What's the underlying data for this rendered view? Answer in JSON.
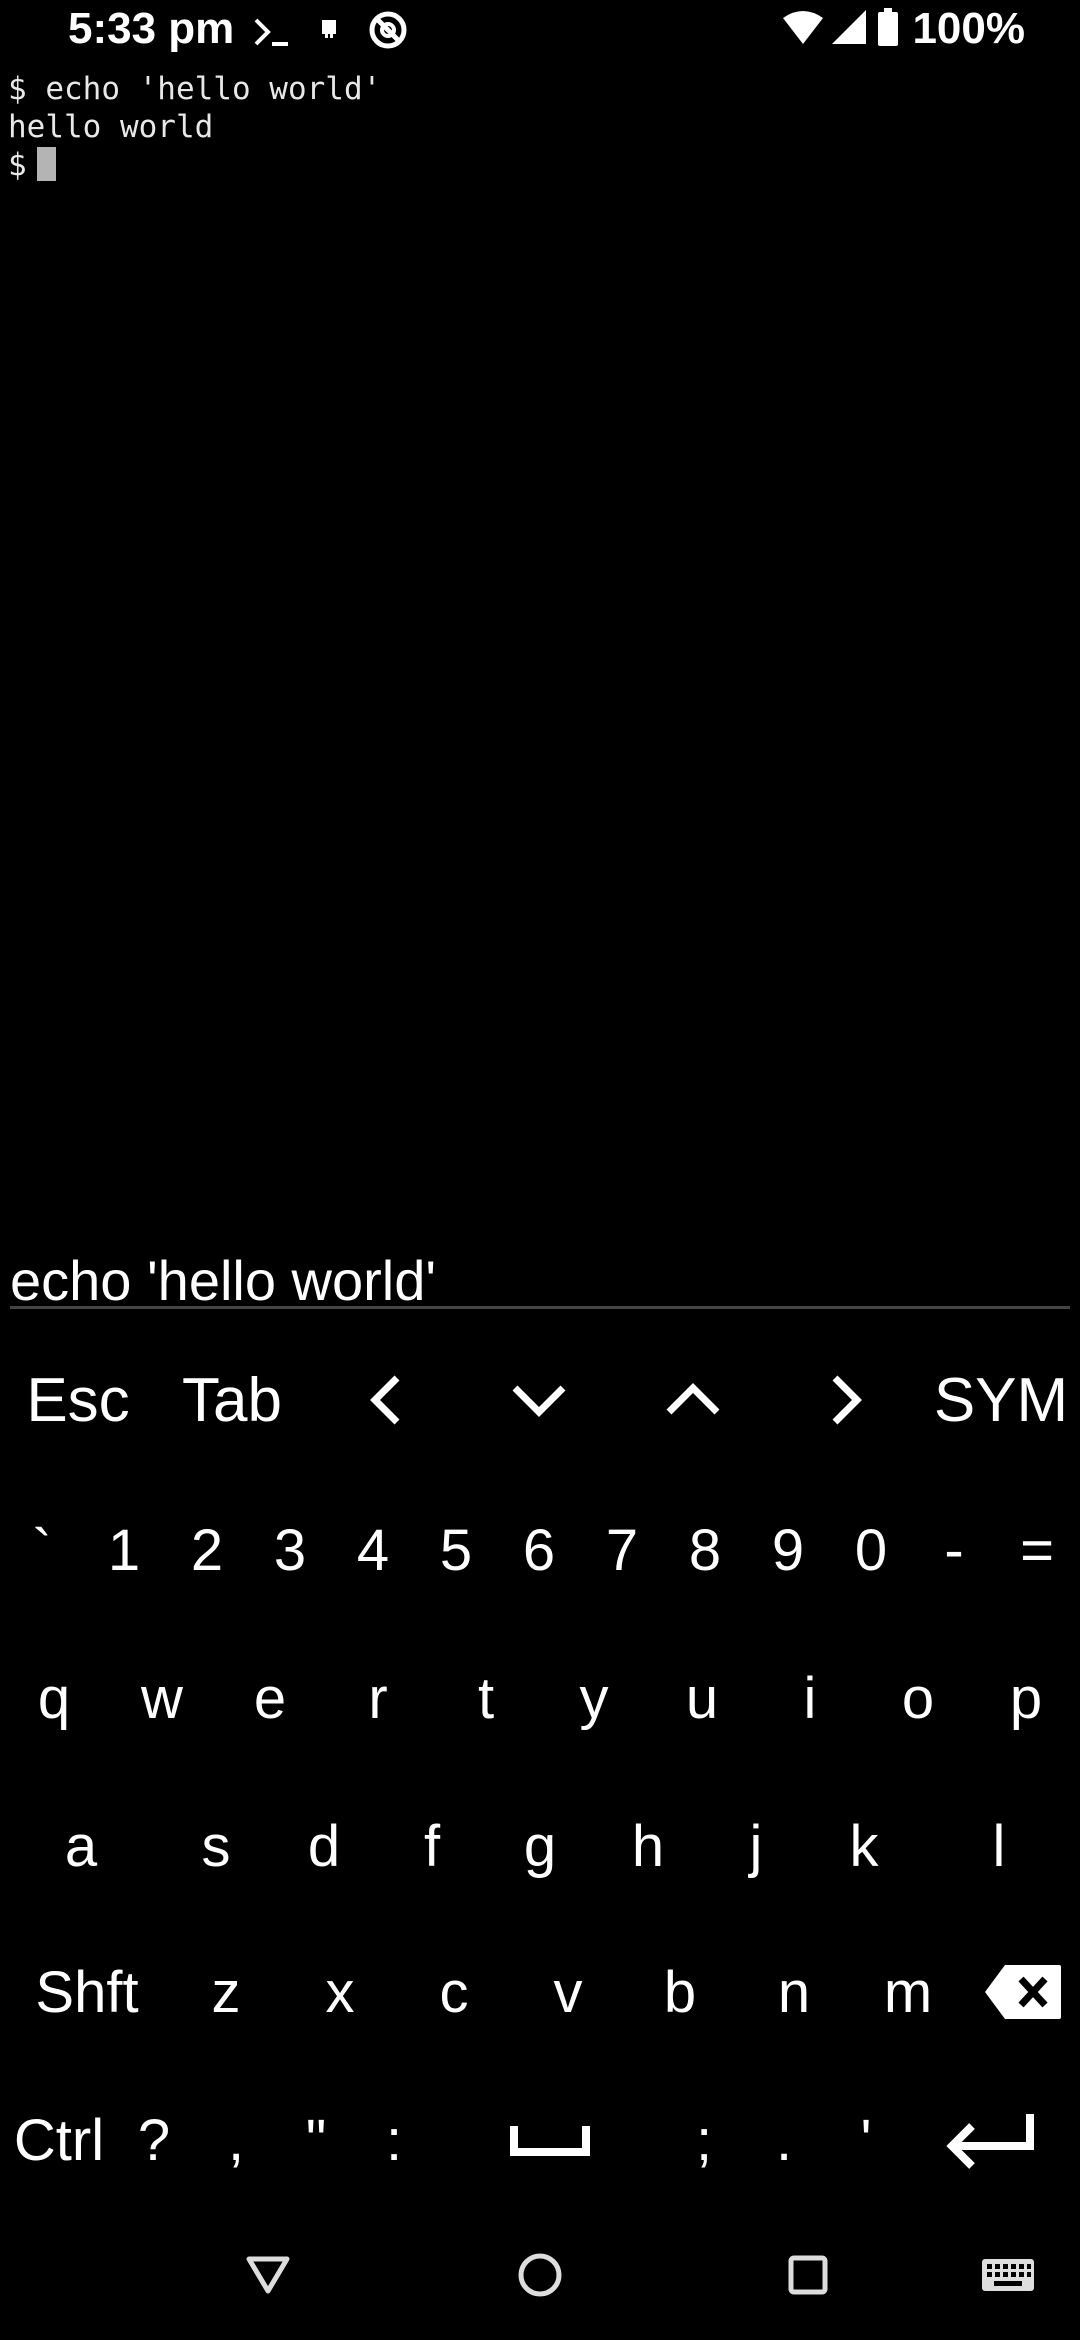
{
  "status_bar": {
    "time": "5:33 pm",
    "battery": "100%",
    "icons": [
      "terminal-icon",
      "notification-icon",
      "do-not-disturb-icon",
      "wifi-icon",
      "cell-signal-icon",
      "battery-icon"
    ]
  },
  "terminal": {
    "lines": [
      "$ echo 'hello world'",
      "hello world",
      "$"
    ]
  },
  "input_bar": {
    "value": "echo 'hello world'"
  },
  "extra_keys": [
    "Esc",
    "Tab",
    "left-arrow-icon",
    "down-arrow-icon",
    "up-arrow-icon",
    "right-arrow-icon",
    "SYM"
  ],
  "extra_key_labels": {
    "esc": "Esc",
    "tab": "Tab",
    "sym": "SYM"
  },
  "keyboard": {
    "row1": [
      "`",
      "1",
      "2",
      "3",
      "4",
      "5",
      "6",
      "7",
      "8",
      "9",
      "0",
      "-",
      "="
    ],
    "row2": [
      "q",
      "w",
      "e",
      "r",
      "t",
      "y",
      "u",
      "i",
      "o",
      "p"
    ],
    "row3": [
      "a",
      "s",
      "d",
      "f",
      "g",
      "h",
      "j",
      "k",
      "l"
    ],
    "row4": [
      "Shft",
      "z",
      "x",
      "c",
      "v",
      "b",
      "n",
      "m"
    ],
    "row5": [
      "Ctrl",
      "?",
      ",",
      "\"",
      ":",
      ";",
      ".",
      "'"
    ]
  },
  "nav_bar": {
    "icons": [
      "back-icon",
      "home-icon",
      "recents-icon",
      "keyboard-icon"
    ]
  }
}
